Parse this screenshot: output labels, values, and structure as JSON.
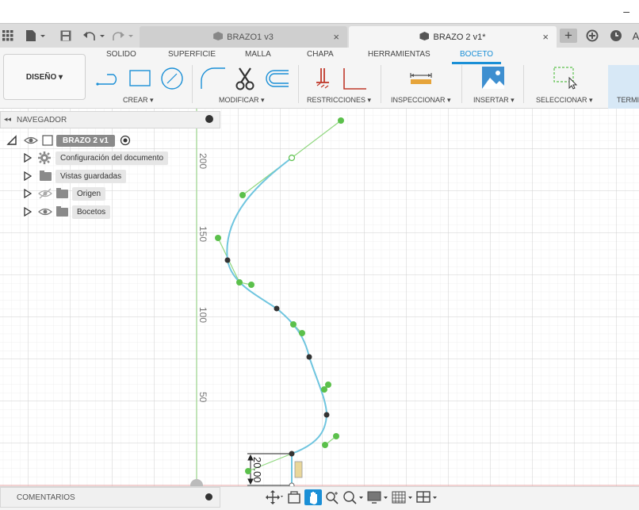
{
  "window": {
    "minimize_glyph": "–"
  },
  "tabbar": {
    "apps_icon": "grid-icon",
    "file_icon": "file-icon",
    "save_icon": "save-icon",
    "undo_icon": "undo-icon",
    "redo_icon": "redo-icon",
    "tabs": [
      {
        "label": "BRAZO1 v3",
        "active": false
      },
      {
        "label": "BRAZO 2 v1*",
        "active": true
      }
    ],
    "close_glyph": "×",
    "new_tab_glyph": "+",
    "extensions_icon": "extensions-icon",
    "job_status_icon": "clock-icon",
    "notifications_glyph": "A"
  },
  "ribbon": {
    "workspace": "DISEÑO ▾",
    "tabs": [
      "SOLIDO",
      "SUPERFICIE",
      "MALLA",
      "CHAPA",
      "HERRAMIENTAS",
      "BOCETO"
    ],
    "active_tab": "BOCETO",
    "groups": {
      "crear": "CREAR ▾",
      "modificar": "MODIFICAR ▾",
      "restricciones": "RESTRICCIONES ▾",
      "inspeccionar": "INSPECCIONAR ▾",
      "insertar": "INSERTAR ▾",
      "seleccionar": "SELECCIONAR ▾",
      "terminar": "TERMI"
    },
    "accent_color": "#1a8fd6"
  },
  "navigator": {
    "title": "NAVEGADOR",
    "root": "BRAZO 2 v1",
    "items": [
      {
        "label": "Configuración del documento",
        "icon": "gear-icon",
        "visibility": false
      },
      {
        "label": "Vistas guardadas",
        "icon": "folder-icon",
        "visibility": false
      },
      {
        "label": "Origen",
        "icon": "folder-icon",
        "visibility": "hidden"
      },
      {
        "label": "Bocetos",
        "icon": "folder-icon",
        "visibility": "visible"
      }
    ]
  },
  "canvas": {
    "axis_labels": [
      "200",
      "150",
      "100",
      "50"
    ],
    "dimension": "20.00",
    "spline_color": "#6fc5df",
    "handle_color": "#5bc04b"
  },
  "bottombar": {
    "comments": "COMENTARIOS",
    "view_tools": [
      "orbit-icon",
      "look-at-icon",
      "pan-icon",
      "zoom-icon",
      "fit-icon",
      "display-icon",
      "grid-icon",
      "viewports-icon"
    ]
  }
}
